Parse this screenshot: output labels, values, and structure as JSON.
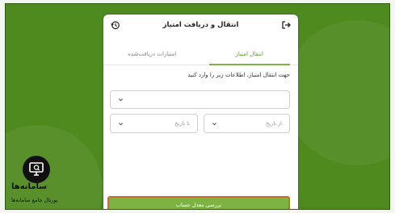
{
  "card": {
    "title": "انتقال و دریافت امتیاز",
    "tabs": [
      {
        "label": "انتقال امتیاز",
        "active": true
      },
      {
        "label": "امتیازات دریافت‌شده",
        "active": false
      }
    ],
    "instruction": "جهت انتقال امتیاز، اطلاعات زیر را وارد کنید",
    "main_select": {
      "value": ""
    },
    "from_date": {
      "placeholder": "از تاریخ"
    },
    "to_date": {
      "placeholder": "تا تاریخ"
    },
    "submit_label": "بررسی معدل حساب"
  },
  "logo": {
    "name": "سامانه‌ها",
    "tagline": "پورتال جامع سامانه‌ها"
  },
  "colors": {
    "background": "#4f8a1f",
    "accent": "#7cb342",
    "button_border": "#c0722b"
  },
  "icons": [
    "exit-icon",
    "history-icon",
    "chevron-down-icon",
    "monitor-search-icon"
  ]
}
